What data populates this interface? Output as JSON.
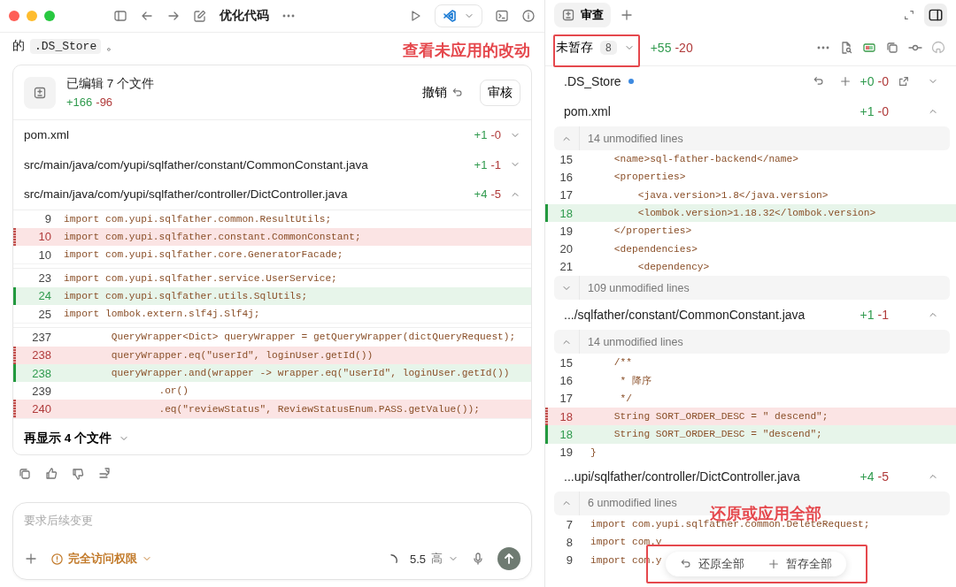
{
  "toolbar": {
    "title": "优化代码"
  },
  "chat": {
    "intro_prefix": "的",
    "intro_code": ".DS_Store",
    "intro_suffix": "。",
    "annotation": "查看未应用的改动"
  },
  "changes_card": {
    "title": "已编辑 7 个文件",
    "added": "+166",
    "removed": "-96",
    "undo": "撤销",
    "review": "审核",
    "files": [
      {
        "path": "pom.xml",
        "added": "+1",
        "removed": "-0",
        "expanded": false
      },
      {
        "path": "src/main/java/com/yupi/sqlfather/constant/CommonConstant.java",
        "added": "+1",
        "removed": "-1",
        "expanded": false
      },
      {
        "path": "src/main/java/com/yupi/sqlfather/controller/DictController.java",
        "added": "+4",
        "removed": "-5",
        "expanded": true
      }
    ],
    "hunks": [
      {
        "lines": [
          {
            "number": "9",
            "kind": "context",
            "code": "import com.yupi.sqlfather.common.ResultUtils;"
          },
          {
            "number": "10",
            "kind": "removed",
            "code": "import com.yupi.sqlfather.constant.CommonConstant;"
          },
          {
            "number": "10",
            "kind": "context",
            "code": "import com.yupi.sqlfather.core.GeneratorFacade;"
          }
        ]
      },
      {
        "lines": [
          {
            "number": "23",
            "kind": "context",
            "code": "import com.yupi.sqlfather.service.UserService;"
          },
          {
            "number": "24",
            "kind": "added",
            "code": "import com.yupi.sqlfather.utils.SqlUtils;"
          },
          {
            "number": "25",
            "kind": "context",
            "code": "import lombok.extern.slf4j.Slf4j;"
          }
        ]
      },
      {
        "lines": [
          {
            "number": "237",
            "kind": "context",
            "code": "        QueryWrapper<Dict> queryWrapper = getQueryWrapper(dictQueryRequest);"
          },
          {
            "number": "238",
            "kind": "removed",
            "code": "        queryWrapper.eq(\"userId\", loginUser.getId())"
          },
          {
            "number": "238",
            "kind": "added",
            "code": "        queryWrapper.and(wrapper -> wrapper.eq(\"userId\", loginUser.getId())"
          },
          {
            "number": "239",
            "kind": "context",
            "code": "                .or()"
          },
          {
            "number": "240",
            "kind": "removed",
            "code": "                .eq(\"reviewStatus\", ReviewStatusEnum.PASS.getValue());"
          }
        ]
      }
    ],
    "show_more": "再显示 4 个文件"
  },
  "composer": {
    "placeholder": "要求后续变更",
    "access": "完全访问权限",
    "model": "5.5",
    "effort": "高"
  },
  "review_panel": {
    "tab": "审查",
    "status": "未暂存",
    "count": "8",
    "added": "+55",
    "removed": "-20",
    "files": [
      {
        "name": ".DS_Store",
        "marked": true,
        "actions_visible": true,
        "added": "+0",
        "removed": "-0",
        "expanded": false
      },
      {
        "name": "pom.xml",
        "marked": false,
        "actions_visible": false,
        "added": "+1",
        "removed": "-0",
        "expanded": true,
        "body": [
          {
            "kind": "fold",
            "label": "14 unmodified lines",
            "expanded": true
          },
          {
            "kind": "context",
            "number": "15",
            "code": "    <name>sql-father-backend</name>"
          },
          {
            "kind": "context",
            "number": "16",
            "code": "    <properties>"
          },
          {
            "kind": "context",
            "number": "17",
            "code": "        <java.version>1.8</java.version>"
          },
          {
            "kind": "added",
            "number": "18",
            "code": "        <lombok.version>1.18.32</lombok.version>"
          },
          {
            "kind": "context",
            "number": "19",
            "code": "    </properties>"
          },
          {
            "kind": "context",
            "number": "20",
            "code": "    <dependencies>"
          },
          {
            "kind": "context",
            "number": "21",
            "code": "        <dependency>"
          },
          {
            "kind": "fold",
            "label": "109 unmodified lines",
            "expanded": false
          }
        ]
      },
      {
        "name": ".../sqlfather/constant/CommonConstant.java",
        "marked": false,
        "actions_visible": false,
        "added": "+1",
        "removed": "-1",
        "expanded": true,
        "body": [
          {
            "kind": "fold",
            "label": "14 unmodified lines",
            "expanded": true
          },
          {
            "kind": "context",
            "number": "15",
            "code": "    /**"
          },
          {
            "kind": "context",
            "number": "16",
            "code": "     * 降序"
          },
          {
            "kind": "context",
            "number": "17",
            "code": "     */"
          },
          {
            "kind": "removed",
            "number": "18",
            "code": "    String SORT_ORDER_DESC = \" descend\";"
          },
          {
            "kind": "added",
            "number": "18",
            "code": "    String SORT_ORDER_DESC = \"descend\";"
          },
          {
            "kind": "context",
            "number": "19",
            "code": "}"
          }
        ]
      },
      {
        "name": "...upi/sqlfather/controller/DictController.java",
        "marked": false,
        "actions_visible": false,
        "added": "+4",
        "removed": "-5",
        "expanded": true,
        "body": [
          {
            "kind": "fold",
            "label": "6 unmodified lines",
            "expanded": true
          },
          {
            "kind": "context",
            "number": "7",
            "code": "import com.yupi.sqlfather.common.DeleteRequest;"
          },
          {
            "kind": "context",
            "number": "8",
            "code": "import com.y"
          },
          {
            "kind": "context",
            "number": "9",
            "code": "import com.y"
          }
        ]
      }
    ],
    "annotation": "还原或应用全部",
    "revert_all": "还原全部",
    "stage_all": "暂存全部"
  }
}
